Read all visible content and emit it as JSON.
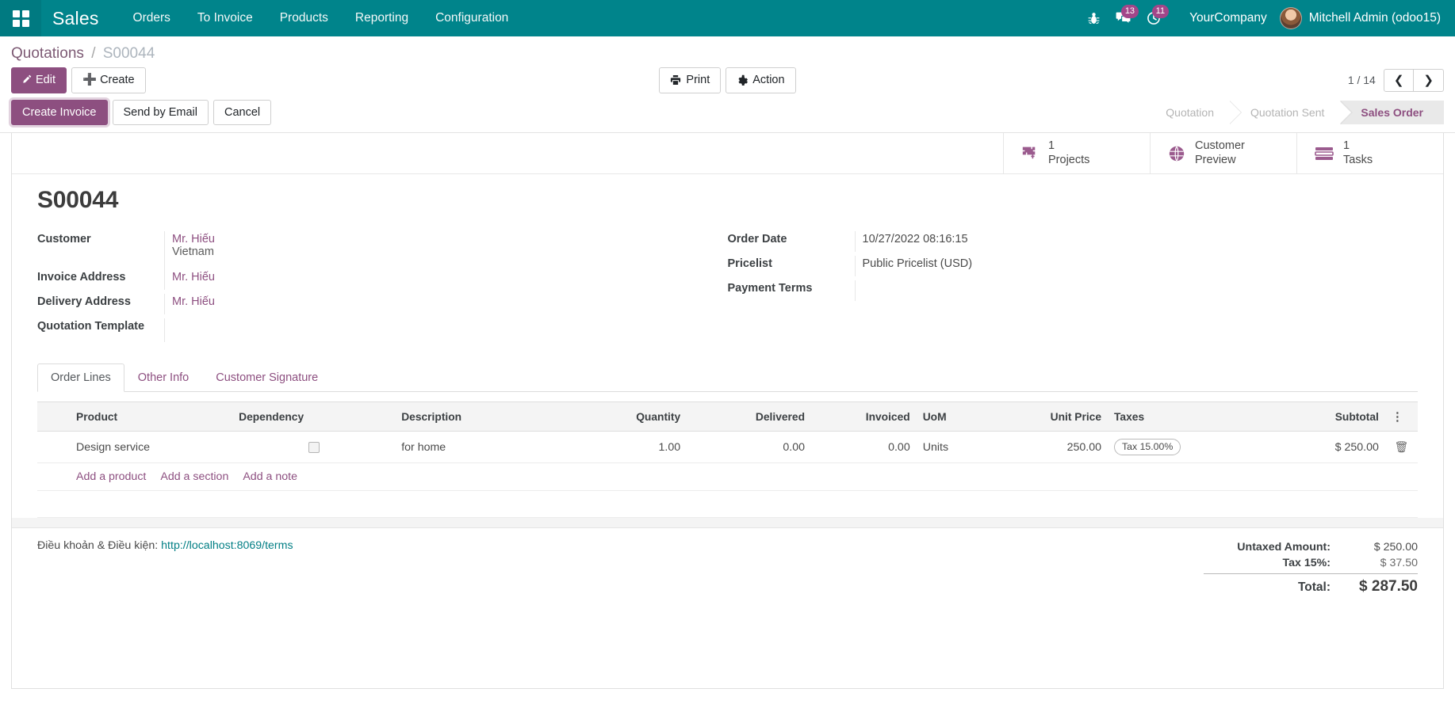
{
  "navbar": {
    "apps_icon": "apps-grid-icon",
    "brand": "Sales",
    "menu": [
      "Orders",
      "To Invoice",
      "Products",
      "Reporting",
      "Configuration"
    ],
    "debug_icon": "bug-icon",
    "messages_icon": "messages-icon",
    "messages_count": "13",
    "activities_icon": "clock-activities-icon",
    "activities_count": "11",
    "company": "YourCompany",
    "user": "Mitchell Admin (odoo15)"
  },
  "breadcrumb": {
    "root": "Quotations",
    "separator": "/",
    "current": "S00044"
  },
  "control_panel": {
    "edit": "Edit",
    "create": "Create",
    "print": "Print",
    "action": "Action",
    "pager": "1 / 14",
    "prev_icon": "chevron-left-icon",
    "next_icon": "chevron-right-icon"
  },
  "status_actions": {
    "create_invoice": "Create Invoice",
    "send_by_email": "Send by Email",
    "cancel": "Cancel"
  },
  "statusbar": {
    "stages": [
      {
        "label": "Quotation",
        "state": "done"
      },
      {
        "label": "Quotation Sent",
        "state": "done"
      },
      {
        "label": "Sales Order",
        "state": "active"
      }
    ]
  },
  "smart_buttons": [
    {
      "icon": "puzzle-projects-icon",
      "value": "1",
      "label": "Projects"
    },
    {
      "icon": "globe-preview-icon",
      "value": "Customer",
      "label": "Preview"
    },
    {
      "icon": "tasks-list-icon",
      "value": "1",
      "label": "Tasks"
    }
  ],
  "record": {
    "title": "S00044"
  },
  "form": {
    "left": [
      {
        "label": "Customer",
        "value": "Mr. Hiếu",
        "sub": "Vietnam",
        "link": true
      },
      {
        "label": "Invoice Address",
        "value": "Mr. Hiếu",
        "link": true
      },
      {
        "label": "Delivery Address",
        "value": "Mr. Hiếu",
        "link": true
      },
      {
        "label": "Quotation Template",
        "value": "",
        "link": false
      }
    ],
    "right": [
      {
        "label": "Order Date",
        "value": "10/27/2022 08:16:15"
      },
      {
        "label": "Pricelist",
        "value": "Public Pricelist (USD)"
      },
      {
        "label": "Payment Terms",
        "value": ""
      }
    ]
  },
  "notebook": {
    "tabs": [
      {
        "label": "Order Lines",
        "active": true
      },
      {
        "label": "Other Info",
        "active": false
      },
      {
        "label": "Customer Signature",
        "active": false
      }
    ]
  },
  "lines_table": {
    "columns": [
      "Product",
      "Dependency",
      "Description",
      "Quantity",
      "Delivered",
      "Invoiced",
      "UoM",
      "Unit Price",
      "Taxes",
      "Subtotal"
    ],
    "options_icon": "column-options-icon",
    "rows": [
      {
        "product": "Design service",
        "dependency_checked": false,
        "description": "for home",
        "quantity": "1.00",
        "delivered": "0.00",
        "invoiced": "0.00",
        "uom": "Units",
        "unit_price": "250.00",
        "taxes": "Tax 15.00%",
        "subtotal": "$ 250.00",
        "delete_icon": "trash-icon"
      }
    ],
    "add_links": [
      "Add a product",
      "Add a section",
      "Add a note"
    ]
  },
  "footer": {
    "terms_label": "Điều khoản & Điều kiện:",
    "terms_url": "http://localhost:8069/terms",
    "totals": [
      {
        "label": "Untaxed Amount:",
        "value": "$ 250.00",
        "kind": "normal"
      },
      {
        "label": "Tax 15%:",
        "value": "$ 37.50",
        "kind": "sub"
      },
      {
        "label": "Total:",
        "value": "$ 287.50",
        "kind": "total"
      }
    ]
  },
  "colors": {
    "navbar": "#00848b",
    "accent": "#8d4f80",
    "link_teal": "#017e84",
    "badge": "#a24689"
  }
}
